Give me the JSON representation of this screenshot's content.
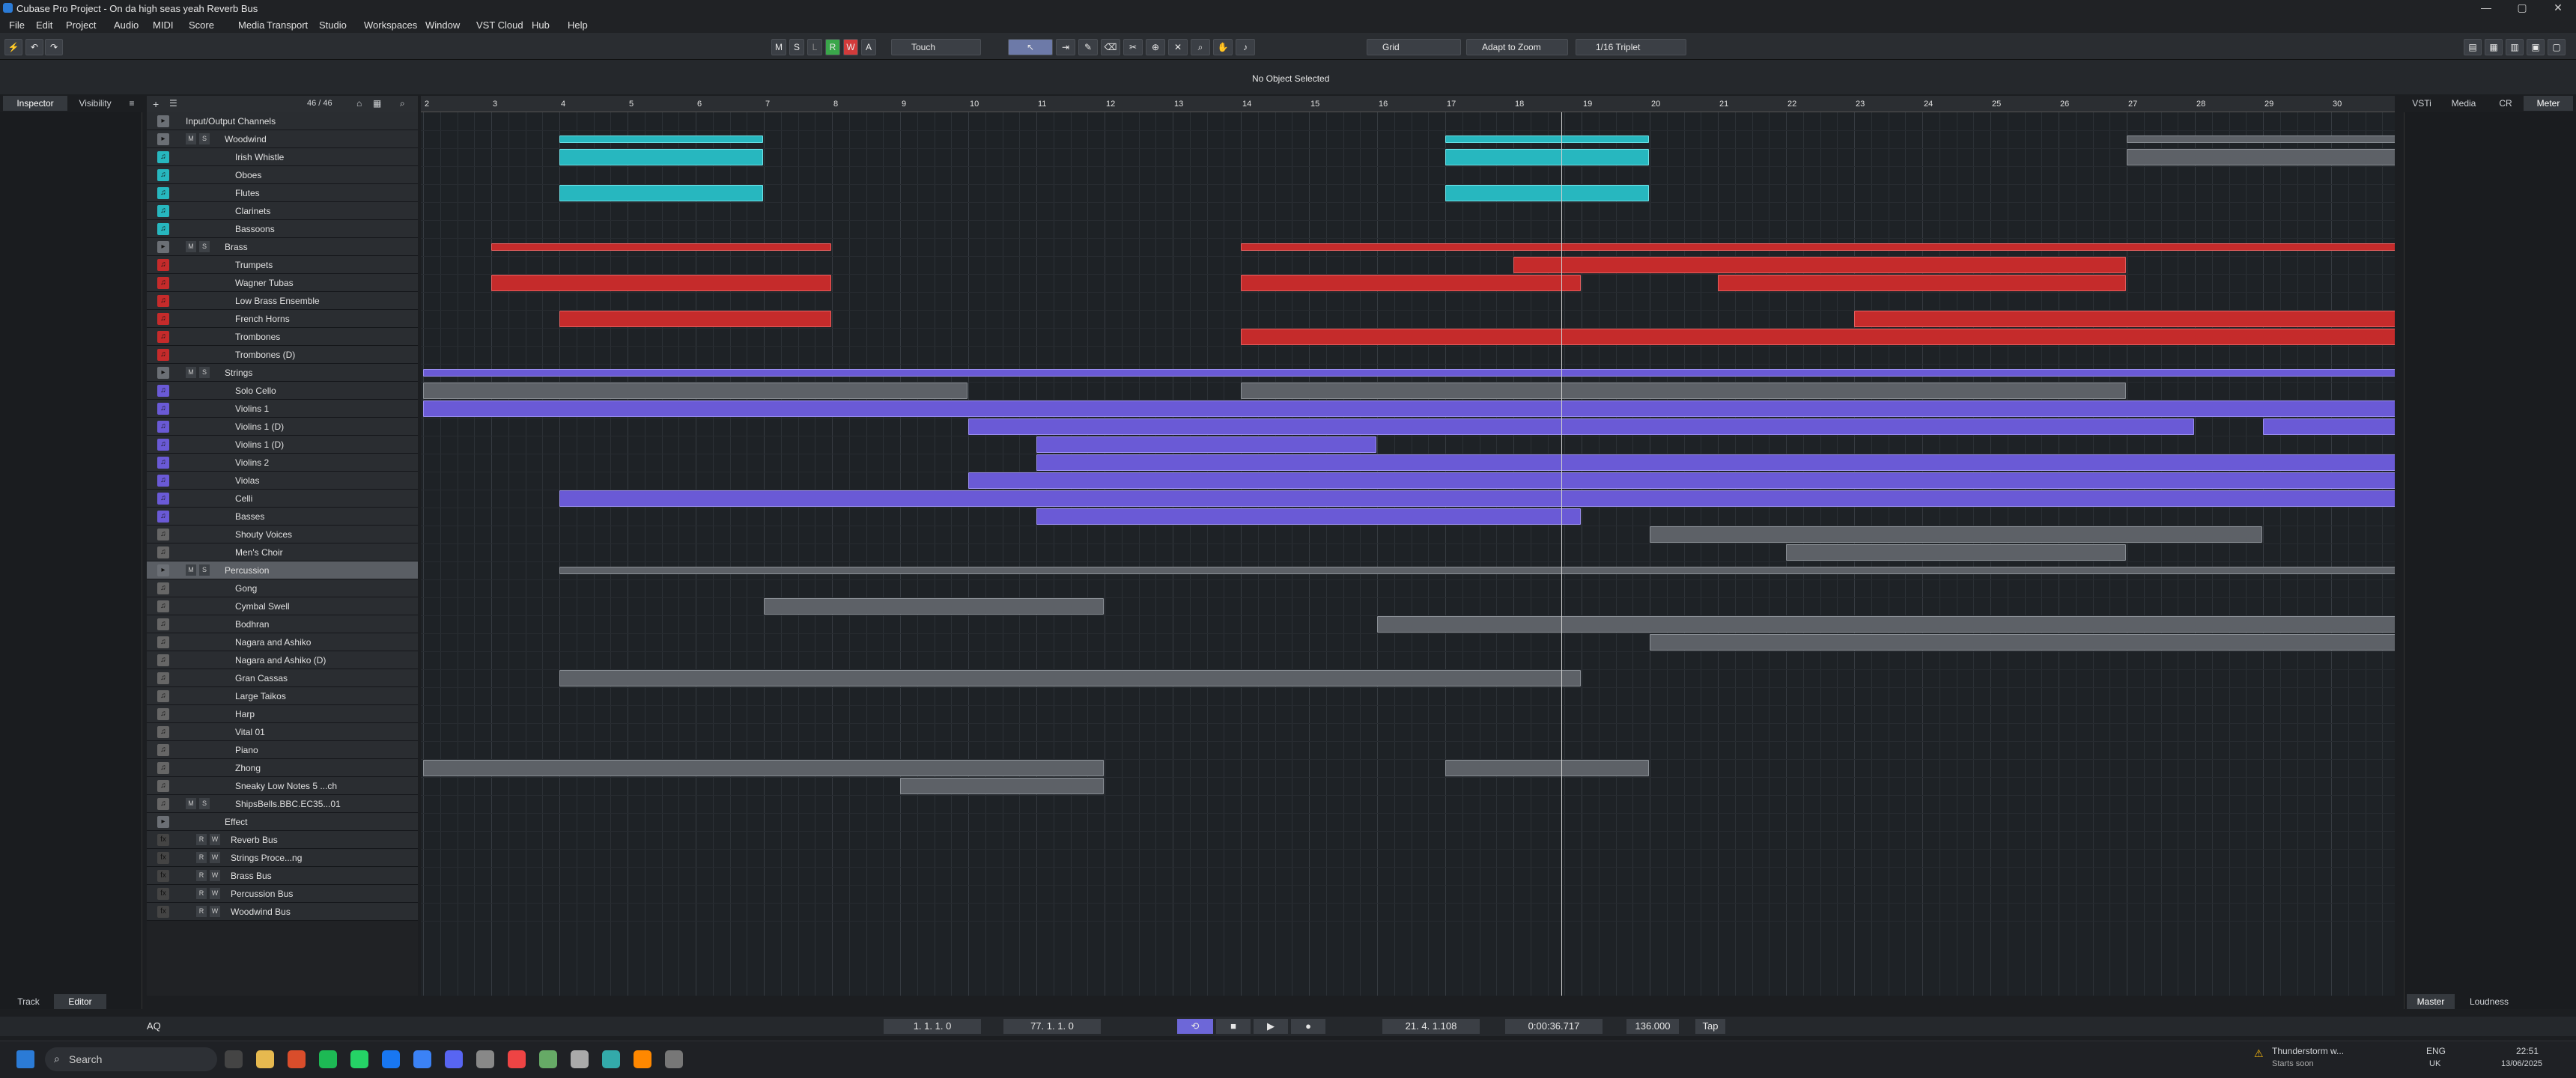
{
  "window": {
    "title": "Cubase Pro Project - On da high seas yeah Reverb Bus",
    "controls": [
      "—",
      "▢",
      "✕"
    ]
  },
  "menu": [
    "File",
    "Edit",
    "Project",
    "Audio",
    "MIDI",
    "Score",
    "Media",
    "Transport",
    "Studio",
    "Workspaces",
    "Window",
    "VST Cloud",
    "Hub",
    "Help"
  ],
  "toolbar": {
    "m": "M",
    "s": "S",
    "l": "L",
    "r": "R",
    "w": "W",
    "a": "A",
    "automation": "Touch",
    "snap": "Grid",
    "zoom": "Adapt to Zoom",
    "quantize": "1/16 Triplet"
  },
  "info": {
    "message": "No Object Selected"
  },
  "left_tabs": {
    "inspector": "Inspector",
    "visibility": "Visibility"
  },
  "right_tabs": {
    "vsti": "VSTi",
    "media": "Media",
    "cr": "CR",
    "meter": "Meter"
  },
  "bottom_left_tabs": {
    "track": "Track",
    "editor": "Editor"
  },
  "bottom_right_tabs": {
    "master": "Master",
    "loudness": "Loudness"
  },
  "track_count": "46 / 46",
  "ruler": [
    "2",
    "3",
    "4",
    "5",
    "6",
    "7",
    "8",
    "9",
    "10",
    "11",
    "12",
    "13",
    "14",
    "15",
    "16",
    "17",
    "18",
    "19",
    "20",
    "21",
    "22",
    "23",
    "24",
    "25",
    "26",
    "27",
    "28",
    "29",
    "30"
  ],
  "tracks": [
    {
      "name": "Input/Output Channels",
      "folder": true
    },
    {
      "name": "Woodwind",
      "folder": true,
      "ms": true
    },
    {
      "name": "Irish Whistle",
      "color": "#27b7bf"
    },
    {
      "name": "Oboes",
      "color": "#27b7bf"
    },
    {
      "name": "Flutes",
      "color": "#27b7bf"
    },
    {
      "name": "Clarinets",
      "color": "#27b7bf"
    },
    {
      "name": "Bassoons",
      "color": "#27b7bf"
    },
    {
      "name": "Brass",
      "folder": true,
      "ms": true
    },
    {
      "name": "Trumpets",
      "color": "#c52b2b"
    },
    {
      "name": "Wagner Tubas",
      "color": "#c52b2b"
    },
    {
      "name": "Low Brass Ensemble",
      "color": "#c52b2b"
    },
    {
      "name": "French Horns",
      "color": "#c52b2b"
    },
    {
      "name": "Trombones",
      "color": "#c52b2b"
    },
    {
      "name": "Trombones (D)",
      "color": "#c52b2b"
    },
    {
      "name": "Strings",
      "folder": true,
      "ms": true
    },
    {
      "name": "Solo Cello",
      "color": "#6a5ad6"
    },
    {
      "name": "Violins 1",
      "color": "#6a5ad6"
    },
    {
      "name": "Violins 1 (D)",
      "color": "#6a5ad6"
    },
    {
      "name": "Violins 1 (D)",
      "color": "#6a5ad6"
    },
    {
      "name": "Violins 2",
      "color": "#6a5ad6"
    },
    {
      "name": "Violas",
      "color": "#6a5ad6"
    },
    {
      "name": "Celli",
      "color": "#6a5ad6"
    },
    {
      "name": "Basses",
      "color": "#6a5ad6"
    },
    {
      "name": "Shouty Voices",
      "color": "#666"
    },
    {
      "name": "Men's Choir",
      "color": "#666"
    },
    {
      "name": "Percussion",
      "folder": true,
      "ms": true,
      "selected": true
    },
    {
      "name": "Gong",
      "color": "#666"
    },
    {
      "name": "Cymbal Swell",
      "color": "#666"
    },
    {
      "name": "Bodhran",
      "color": "#666"
    },
    {
      "name": "Nagara and Ashiko",
      "color": "#666"
    },
    {
      "name": "Nagara and Ashiko (D)",
      "color": "#666"
    },
    {
      "name": "Gran Cassas",
      "color": "#666"
    },
    {
      "name": "Large Taikos",
      "color": "#666"
    },
    {
      "name": "Harp",
      "color": "#666"
    },
    {
      "name": "Vital 01",
      "color": "#666"
    },
    {
      "name": "Piano",
      "color": "#666"
    },
    {
      "name": "Zhong",
      "color": "#666"
    },
    {
      "name": "Sneaky Low Notes 5 ...ch",
      "color": "#666"
    },
    {
      "name": "ShipsBells.BBC.EC35...01",
      "color": "#666",
      "ms": true
    },
    {
      "name": "Effect",
      "folder": true
    },
    {
      "name": "Reverb Bus",
      "fx": true
    },
    {
      "name": "Strings Proce...ng",
      "fx": true
    },
    {
      "name": "Brass Bus",
      "fx": true
    },
    {
      "name": "Percussion Bus",
      "fx": true
    },
    {
      "name": "Woodwind Bus",
      "fx": true
    }
  ],
  "transport": {
    "left_locator": "1. 1. 1. 0",
    "right_locator": "77. 1. 1. 0",
    "position_bars": "21. 4. 1.108",
    "position_time": "0:00:36.717",
    "tempo": "136.000",
    "tap": "Tap",
    "aq": "AQ"
  },
  "taskbar": {
    "search": "Search",
    "weather": "Thunderstorm w...",
    "weather_sub": "Starts soon",
    "lang": "ENG",
    "region": "UK",
    "time": "22:51",
    "date": "13/06/2025"
  }
}
